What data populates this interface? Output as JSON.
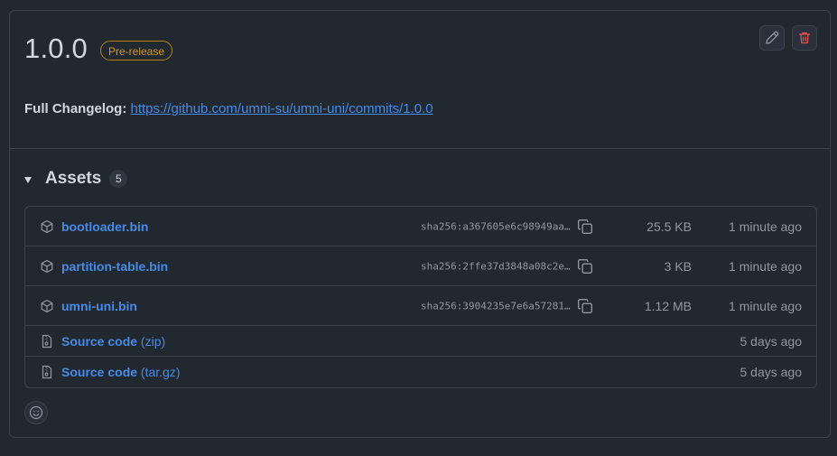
{
  "release": {
    "title": "1.0.0",
    "badge": "Pre-release",
    "changelog_label": "Full Changelog:",
    "changelog_link": "https://github.com/umni-su/umni-uni/commits/1.0.0"
  },
  "assets": {
    "title": "Assets",
    "count": "5",
    "items": [
      {
        "name": "bootloader.bin",
        "sha": "sha256:a367605e6c98949aa…",
        "size": "25.5 KB",
        "time": "1 minute ago",
        "icon": "package-icon"
      },
      {
        "name": "partition-table.bin",
        "sha": "sha256:2ffe37d3848a08c2e…",
        "size": "3 KB",
        "time": "1 minute ago",
        "icon": "package-icon"
      },
      {
        "name": "umni-uni.bin",
        "sha": "sha256:3904235e7e6a57281…",
        "size": "1.12 MB",
        "time": "1 minute ago",
        "icon": "package-icon"
      },
      {
        "name": "Source code",
        "ext": "(zip)",
        "time": "5 days ago",
        "icon": "file-zip-icon"
      },
      {
        "name": "Source code",
        "ext": "(tar.gz)",
        "time": "5 days ago",
        "icon": "file-zip-icon"
      }
    ]
  },
  "icons": {
    "edit": "pencil-icon",
    "delete": "trash-icon",
    "copy": "copy-icon",
    "reaction": "smiley-icon"
  },
  "colors": {
    "link": "#478be6",
    "badge": "#d29922",
    "danger": "#e5534b"
  }
}
